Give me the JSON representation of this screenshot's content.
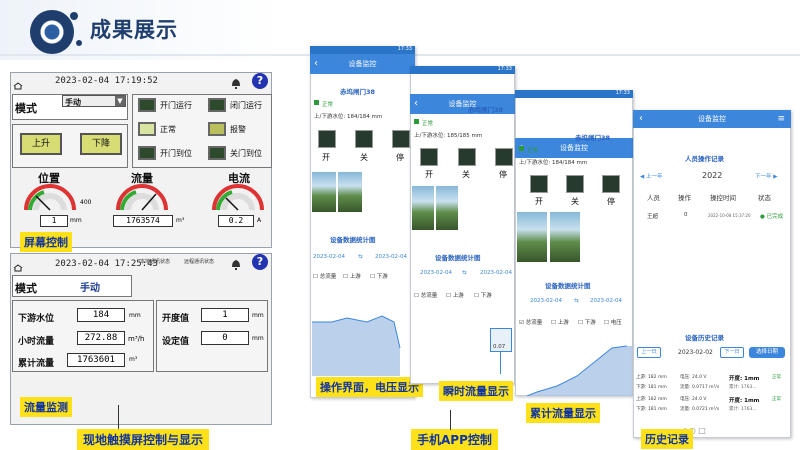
{
  "header": {
    "title": "成果展示"
  },
  "hmi1": {
    "datetime": "2023-02-04 17:19:52",
    "mode_label": "模式",
    "mode_value": "手动",
    "btn_up": "上升",
    "btn_down": "下降",
    "status": [
      {
        "label": "开门运行",
        "lit": false
      },
      {
        "label": "闭门运行",
        "lit": false
      },
      {
        "label": "正常",
        "lit": true
      },
      {
        "label": "报警",
        "lit": true
      },
      {
        "label": "开门到位",
        "lit": false
      },
      {
        "label": "关门到位",
        "lit": false
      }
    ],
    "gauges": [
      {
        "title": "位置",
        "value": "1",
        "unit": "mm",
        "scale": "400"
      },
      {
        "title": "流量",
        "value": "1763574",
        "unit": "m³"
      },
      {
        "title": "电流",
        "value": "0.2",
        "unit": "A"
      }
    ],
    "tag": "屏幕控制"
  },
  "hmi2": {
    "datetime": "2023-02-04 17:25:43",
    "mini_left": "本地通讯状态",
    "mini_right": "远程通讯状态",
    "mode_label": "模式",
    "mode_value": "手动",
    "rows": [
      {
        "label": "下游水位",
        "value": "184",
        "unit": "mm"
      },
      {
        "label": "小时流量",
        "value": "272.88",
        "unit": "m³/h"
      },
      {
        "label": "累计流量",
        "value": "1763601",
        "unit": "m³"
      }
    ],
    "right_rows": [
      {
        "label": "开度值",
        "value": "1",
        "unit": "mm"
      },
      {
        "label": "设定值",
        "value": "0",
        "unit": "mm"
      }
    ],
    "tag": "流量监测"
  },
  "bottom_label_left": "现地触摸屏控制与显示",
  "bottom_label_right": "手机APP控制",
  "phone1": {
    "time": "17:33",
    "nav_title": "设备监控",
    "device": "赤坞闸门38",
    "status": "正常",
    "water_levels": "上/下游水位: 184/184 mm",
    "ctrl": [
      "开",
      "关",
      "停"
    ],
    "stats_title": "设备数据统计图",
    "date_a": "2023-02-04",
    "date_b": "2023-02-04",
    "checks": [
      "总流量",
      "上游",
      "下游"
    ],
    "tag": "操作界面，电压显示"
  },
  "phone2": {
    "time": "17:33",
    "nav_title": "设备监控",
    "device": "赤坞闸门38",
    "status": "正常",
    "water_levels": "上/下游水位: 185/185 mm",
    "ctrl": [
      "开",
      "关",
      "停"
    ],
    "stats_title": "设备数据统计图",
    "date_a": "2023-02-04",
    "date_b": "2023-02-04",
    "checks": [
      "总流量",
      "上游",
      "下游"
    ],
    "bubble": "0.07",
    "tag": "瞬时流量显示"
  },
  "phone3": {
    "time": "17:33",
    "nav_title": "设备监控",
    "device": "赤坞闸门38",
    "status": "正常",
    "water_levels": "上/下游水位: 184/184 mm",
    "ctrl": [
      "开",
      "关",
      "停"
    ],
    "stats_title": "设备数据统计图",
    "date_a": "2023-02-04",
    "date_b": "2023-02-04",
    "checks": [
      "总流量",
      "上游",
      "下游",
      "电压"
    ],
    "tag": "累计流量显示"
  },
  "phone4": {
    "nav_title": "设备监控",
    "section1": "人员操作记录",
    "prev": "上一年",
    "year": "2022",
    "next": "下一年",
    "cols": [
      "人员",
      "操作",
      "操控时间",
      "状态"
    ],
    "row": {
      "user": "王超",
      "op": "0",
      "time": "2022-10-08 15:37:20",
      "state": "已完成"
    },
    "section2": "设备历史记录",
    "prev_day": "上一日",
    "date": "2023-02-02",
    "next_day": "下一日",
    "choose": "选择日期",
    "records": [
      {
        "a": "上游: 182 mm",
        "b": "电压: 24.0 V",
        "c": "开度: 1mm",
        "d": "正常"
      },
      {
        "a": "下游: 181 mm",
        "b": "流量: 0.0717 m³/s",
        "c": "累计: 1763...",
        "d": ""
      },
      {
        "a": "上游: 182 mm",
        "b": "电压: 24.0 V",
        "c": "开度: 1mm",
        "d": "正常"
      },
      {
        "a": "下游: 181 mm",
        "b": "流量: 0.0721 m³/s",
        "c": "累计: 1763...",
        "d": ""
      }
    ],
    "tag": "历史记录"
  }
}
